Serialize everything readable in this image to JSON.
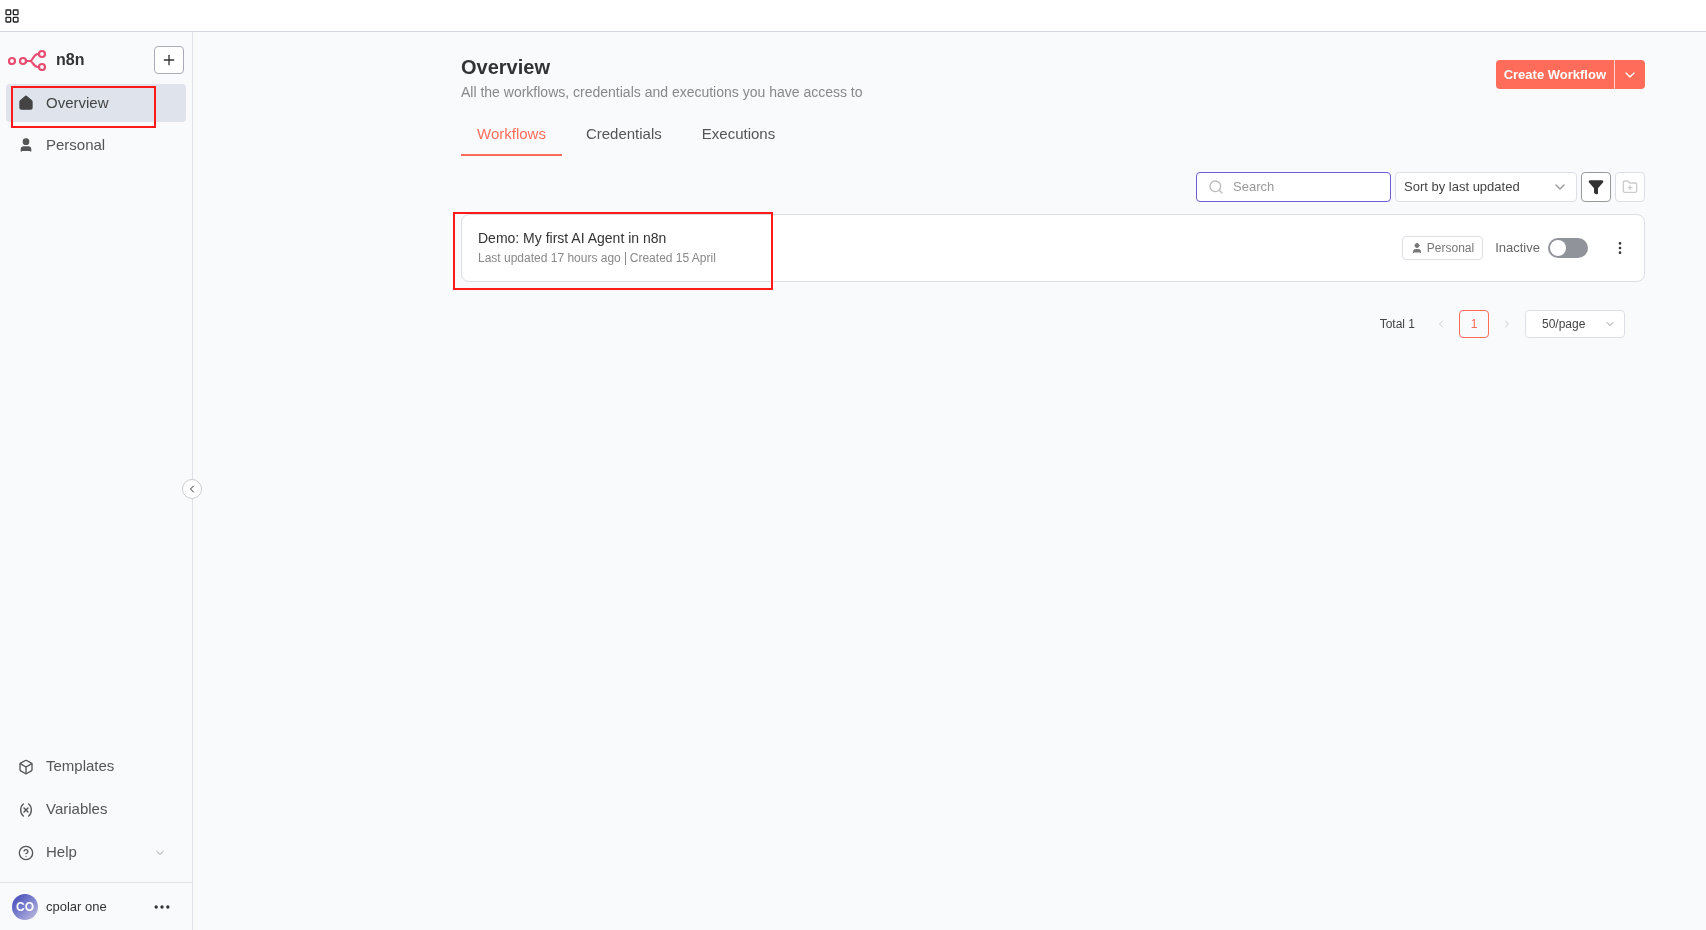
{
  "app": {
    "name": "n8n"
  },
  "sidebar": {
    "items": [
      {
        "label": "Overview",
        "kind": "home",
        "selected": true,
        "highlighted": true
      },
      {
        "label": "Personal",
        "kind": "person",
        "selected": false,
        "highlighted": false
      }
    ],
    "bottom_items": [
      {
        "label": "Templates",
        "kind": "templates",
        "expandable": false
      },
      {
        "label": "Variables",
        "kind": "variables",
        "expandable": false
      },
      {
        "label": "Help",
        "kind": "help",
        "expandable": true
      }
    ],
    "user": {
      "initials": "CO",
      "name": "cpolar one"
    }
  },
  "header": {
    "title": "Overview",
    "subtitle": "All the workflows, credentials and executions you have access to",
    "create_button": "Create Workflow"
  },
  "tabs": [
    {
      "label": "Workflows",
      "selected": true
    },
    {
      "label": "Credentials",
      "selected": false
    },
    {
      "label": "Executions",
      "selected": false
    }
  ],
  "toolbar": {
    "search": {
      "placeholder": "Search"
    },
    "sort": "Sort by last updated"
  },
  "workflows": [
    {
      "name": "Demo: My first AI Agent in n8n",
      "updated": "Last updated 17 hours ago",
      "created": "Created 15 April",
      "owner": "Personal",
      "status": "Inactive",
      "on": false,
      "highlighted": true
    }
  ],
  "pagination": {
    "total": "Total 1",
    "pages": [
      {
        "label": "1",
        "selected": true
      }
    ],
    "page_size": "50/page"
  }
}
